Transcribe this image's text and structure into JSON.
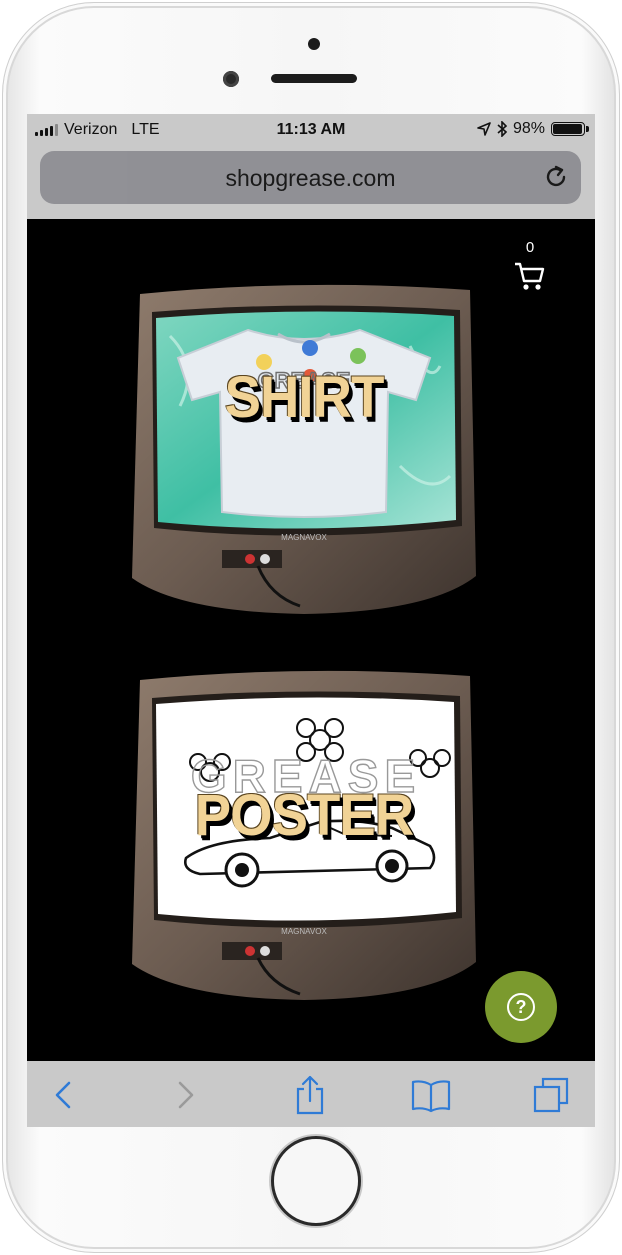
{
  "status": {
    "carrier": "Verizon",
    "network": "LTE",
    "time": "11:13 AM",
    "battery": "98%",
    "battery_level": 0.98
  },
  "browser": {
    "url": "shopgrease.com"
  },
  "cart": {
    "count": "0"
  },
  "products": [
    {
      "label": "SHIRT",
      "shirt_print": "GREASE"
    },
    {
      "label": "POSTER",
      "poster_print": "GREASE"
    }
  ],
  "tv_brand": "MAGNAVOX",
  "colors": {
    "label": "#f1d396",
    "help_button": "#7b9a2e",
    "ios_blue": "#2f7bd6",
    "water": "#3fbfa4"
  },
  "icons": {
    "cart": "cart-icon",
    "reload": "reload-icon",
    "help": "help-icon",
    "back": "back-icon",
    "forward": "forward-icon",
    "share": "share-icon",
    "bookmarks": "bookmarks-icon",
    "tabs": "tabs-icon"
  }
}
